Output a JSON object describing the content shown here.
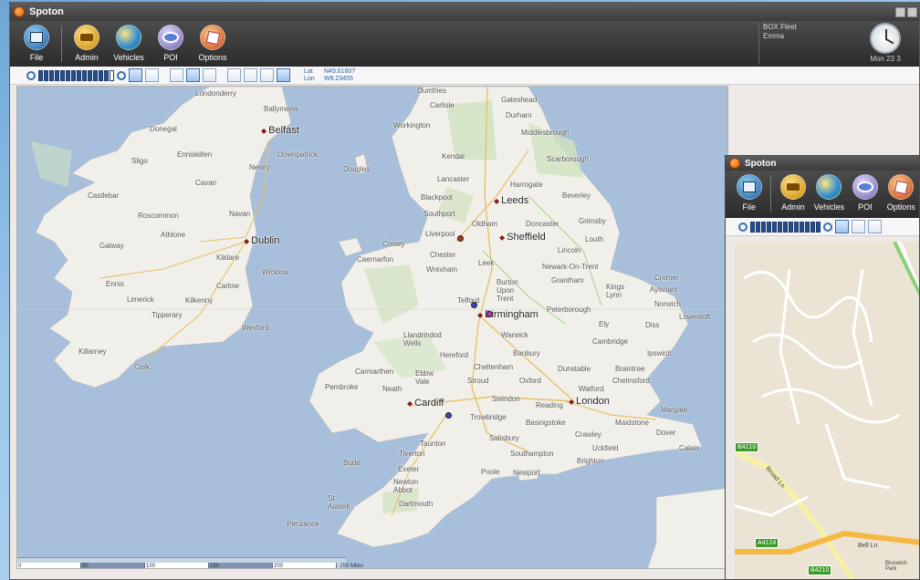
{
  "window_main": {
    "title": "Spoton",
    "ribbon": [
      {
        "label": "File",
        "icon": "file-icon"
      },
      {
        "label": "Admin",
        "icon": "admin-icon"
      },
      {
        "label": "Vehicles",
        "icon": "vehicles-globe-icon"
      },
      {
        "label": "POI",
        "icon": "poi-eye-icon"
      },
      {
        "label": "Options",
        "icon": "options-icon"
      }
    ],
    "fleet": {
      "line1": "BOX Fleet",
      "line2": "Emma"
    },
    "clock": {
      "date": "Mon 23 3"
    },
    "coords": {
      "lat_label": "Lat",
      "lat": "N49.61607",
      "lon_label": "Lon",
      "lon": "W9.23455"
    }
  },
  "map": {
    "cities": {
      "belfast": "Belfast",
      "dublin": "Dublin",
      "leeds": "Leeds",
      "sheffield": "Sheffield",
      "birmingham": "Birmingham",
      "cardiff": "Cardiff",
      "london": "London"
    },
    "places": {
      "londonderry": "Londonderry",
      "ballymena": "Ballymena",
      "donegal": "Donegal",
      "enniskillen": "Enniskillen",
      "downpatrick": "Downpatrick",
      "sligo": "Sligo",
      "newry": "Newry",
      "cavan": "Cavan",
      "douglas": "Douglas",
      "castlebar": "Castlebar",
      "roscommon": "Roscommon",
      "navan": "Navan",
      "athlone": "Athlone",
      "galway": "Galway",
      "kildare": "Kildare",
      "wicklow": "Wicklow",
      "ennis": "Ennis",
      "carlow": "Carlow",
      "limerick": "Limerick",
      "kilkenny": "Kilkenny",
      "tipperary": "Tipperary",
      "wexford": "Wexford",
      "killarney": "Killarney",
      "cork": "Cork",
      "dumfries": "Dumfries",
      "carlisle": "Carlisle",
      "gateshead": "Gateshead",
      "durham": "Durham",
      "workington": "Workington",
      "middlesbrough": "Middlesbrough",
      "kendal": "Kendal",
      "scarborough": "Scarborough",
      "lancaster": "Lancaster",
      "harrogate": "Harrogate",
      "blackpool": "Blackpool",
      "beverley": "Beverley",
      "southport": "Southport",
      "oldham": "Oldham",
      "doncaster": "Doncaster",
      "grimsby": "Grimsby",
      "liverpool": "Liverpool",
      "conwy": "Conwy",
      "louth": "Louth",
      "chester": "Chester",
      "lincoln": "Lincoln",
      "caernarfon": "Caernarfon",
      "wrexham": "Wrexham",
      "leek": "Leek",
      "newark": "Newark-On-Trent",
      "cromer": "Cromer",
      "grantham": "Grantham",
      "burton": "Burton Upon Trent",
      "kings_lynn": "Kings Lynn",
      "aylsham": "Aylsham",
      "telford": "Telford",
      "norwich": "Norwich",
      "peterborough": "Peterborough",
      "lowestoft": "Lowestoft",
      "ely": "Ely",
      "diss": "Diss",
      "llandrindod": "Llandrindod Wells",
      "warwick": "Warwick",
      "cambridge": "Cambridge",
      "hereford": "Hereford",
      "banbury": "Banbury",
      "ipswich": "Ipswich",
      "carmarthen": "Carmarthen",
      "cheltenham": "Cheltenham",
      "dunstable": "Dunstable",
      "braintree": "Braintree",
      "ebbw_vale": "Ebbw Vale",
      "stroud": "Stroud",
      "oxford": "Oxford",
      "chelmsford": "Chelmsford",
      "pembroke": "Pembroke",
      "neath": "Neath",
      "watford": "Watford",
      "swindon": "Swindon",
      "reading": "Reading",
      "margate": "Margate",
      "trowbridge": "Trowbridge",
      "basingstoke": "Basingstoke",
      "maidstone": "Maidstone",
      "dover": "Dover",
      "crawley": "Crawley",
      "salisbury": "Salisbury",
      "taunton": "Taunton",
      "uckfield": "Uckfield",
      "calais": "Calais",
      "tiverton": "Tiverton",
      "southampton": "Southampton",
      "brighton": "Brighton",
      "bude": "Bude",
      "exeter": "Exeter",
      "poole": "Poole",
      "newport": "Newport",
      "newton_abbot": "Newton Abbot",
      "dartmouth": "Dartmouth",
      "st_austell": "St Austell",
      "penzance": "Penzance",
      "lincoln2": "Lincoln"
    },
    "scale": {
      "ticks": [
        "0",
        "50",
        "100",
        "150",
        "200"
      ],
      "end": "250 Miles"
    }
  },
  "window_second": {
    "title": "Spoton",
    "ribbon": [
      "File",
      "Admin",
      "Vehicles",
      "POI",
      "Options"
    ],
    "roads": {
      "b4210_a": "B4210",
      "b4210_b": "B4210",
      "a4124": "A4124",
      "bell_ln": "Bell Ln",
      "broad_ln": "Broad Ln",
      "bloxwich": "Bloxwich Park"
    }
  }
}
